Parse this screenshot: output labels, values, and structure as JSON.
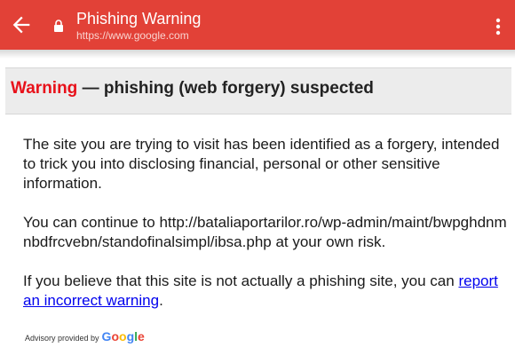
{
  "appbar": {
    "title": "Phishing Warning",
    "url": "https://www.google.com",
    "back_icon": "arrow-left-icon",
    "lock_icon": "lock-icon",
    "menu_icon": "more-vertical-icon",
    "color": "#e24137"
  },
  "warning": {
    "label": "Warning",
    "rest": "— phishing (web forgery) suspected",
    "label_color": "#e8111a"
  },
  "body": {
    "para1": "The site you are trying to visit has been identified as a forgery, intended to trick you into disclosing financial, personal or other sensitive information.",
    "para2": "You can continue to http://bataliaportarilor.ro/wp-admin/maint/bwpghdnmnbdfrcvebn/standofinalsimpl/ibsa.php at your own risk.",
    "para3_prefix": "If you believe that this site is not actually a phishing site, you can ",
    "report_link": "report an incorrect warning",
    "para3_suffix": "."
  },
  "advisory": {
    "text": "Advisory provided by",
    "brand": "Google",
    "brand_letters": [
      "G",
      "o",
      "o",
      "g",
      "l",
      "e"
    ],
    "brand_colors": [
      "#4285f4",
      "#ea4335",
      "#fbbc05",
      "#4285f4",
      "#34a853",
      "#ea4335"
    ]
  }
}
